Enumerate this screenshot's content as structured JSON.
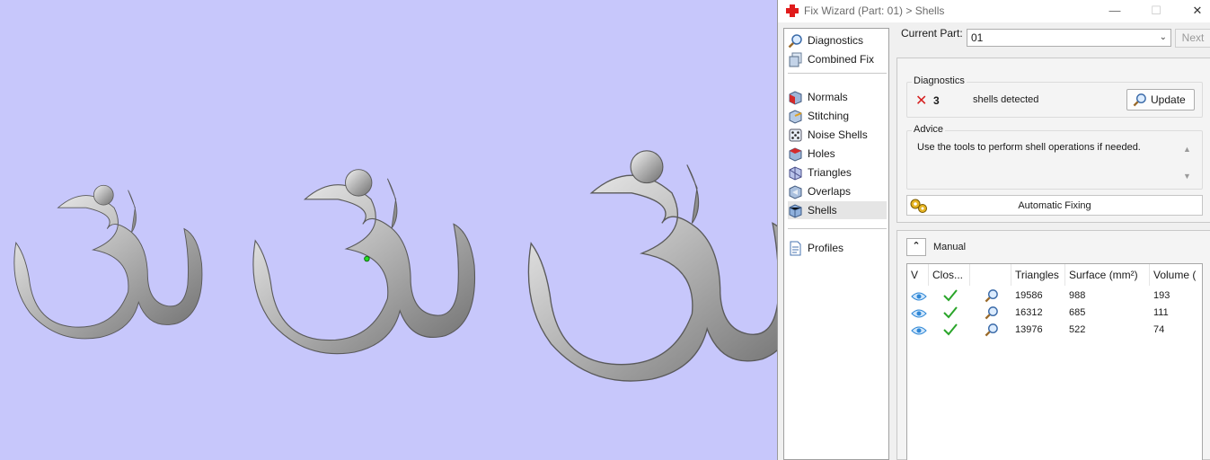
{
  "window": {
    "title": "Fix Wizard (Part: 01) > Shells",
    "controls": {
      "minimize": "—",
      "maximize": "☐",
      "close": "✕"
    }
  },
  "nav": {
    "items": [
      {
        "label": "Diagnostics",
        "icon": "magnifier-icon",
        "active": false
      },
      {
        "label": "Combined Fix",
        "icon": "combined-fix-icon",
        "active": false
      },
      {
        "label": "Normals",
        "icon": "normals-cube-icon",
        "active": false
      },
      {
        "label": "Stitching",
        "icon": "stitching-cube-icon",
        "active": false
      },
      {
        "label": "Noise Shells",
        "icon": "noise-shells-dice-icon",
        "active": false
      },
      {
        "label": "Holes",
        "icon": "holes-cube-icon",
        "active": false
      },
      {
        "label": "Triangles",
        "icon": "triangles-cube-icon",
        "active": false
      },
      {
        "label": "Overlaps",
        "icon": "overlaps-cube-icon",
        "active": false
      },
      {
        "label": "Shells",
        "icon": "shells-cube-icon",
        "active": true
      },
      {
        "label": "Profiles",
        "icon": "profiles-document-icon",
        "active": false
      }
    ]
  },
  "current_part": {
    "label": "Current Part:",
    "value": "01",
    "next_label": "Next"
  },
  "diagnostics": {
    "group_label": "Diagnostics",
    "count": "3",
    "message": "shells detected",
    "update_label": "Update"
  },
  "advice": {
    "group_label": "Advice",
    "text": "Use the tools to perform shell operations if needed."
  },
  "automatic_fixing": {
    "label": "Automatic Fixing"
  },
  "manual": {
    "label": "Manual",
    "toggle_glyph": "⌃",
    "columns": [
      "V",
      "Clos...",
      "",
      "Triangles",
      "Surface (mm²)",
      "Volume ("
    ],
    "rows": [
      {
        "triangles": "19586",
        "surface": "988",
        "volume": "193"
      },
      {
        "triangles": "16312",
        "surface": "685",
        "volume": "111"
      },
      {
        "triangles": "13976",
        "surface": "522",
        "volume": "74"
      }
    ]
  },
  "colors": {
    "viewport_bg": "#c7c7fb",
    "error_red": "#d62020",
    "check_green": "#2aa52a",
    "eye_blue": "#2f87d6"
  }
}
